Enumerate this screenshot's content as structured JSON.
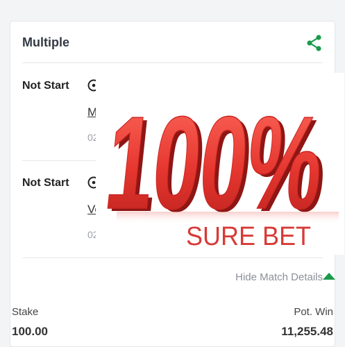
{
  "card": {
    "title": "Multiple",
    "share_icon": "share-icon"
  },
  "matches": [
    {
      "status": "Not Start",
      "sport_icon": "soccer-ball-icon",
      "team": "M",
      "date": "02"
    },
    {
      "status": "Not Start",
      "sport_icon": "soccer-ball-icon",
      "team": "Vo",
      "date": "02"
    }
  ],
  "promo": {
    "headline": "100%",
    "tagline": "SURE BET"
  },
  "details_toggle": {
    "label": "Hide Match Details",
    "icon": "triangle-up-icon"
  },
  "bet": {
    "stake_label": "Stake",
    "stake_value": "100.00",
    "win_label": "Pot. Win",
    "win_value": "11,255.48"
  },
  "colors": {
    "accent_green": "#1a9b4a",
    "promo_red": "#e23a32",
    "promo_text_red": "#d83a36"
  }
}
